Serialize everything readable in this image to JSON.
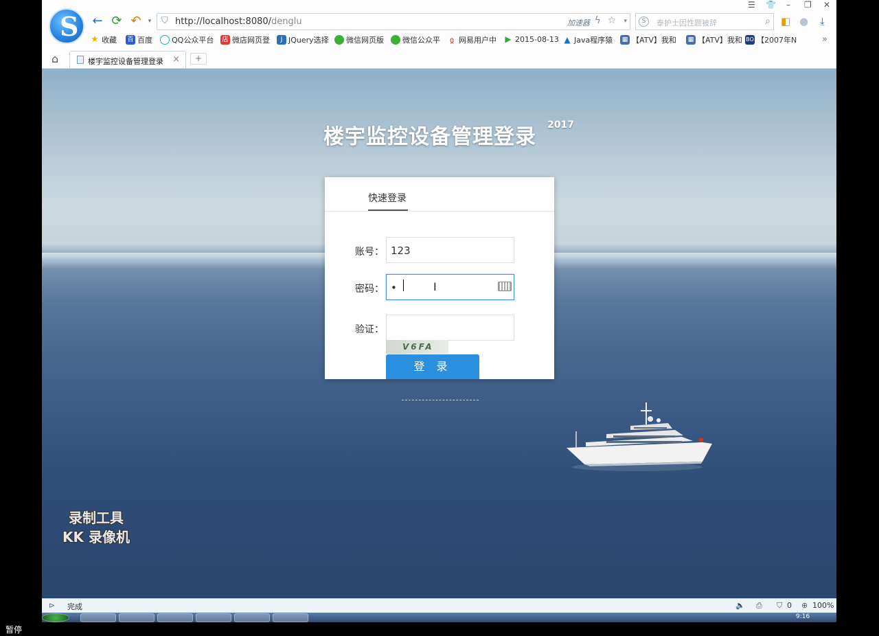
{
  "browser": {
    "logo_letter": "S",
    "address_url_host": "http://localhost:8080/",
    "address_url_path": "denglu",
    "accelerator_label": "加速器",
    "search_placeholder": "泰护士因性题被辞",
    "window_controls": [
      "☰",
      "👕",
      "–",
      "❐",
      "✕"
    ]
  },
  "bookmarks": [
    {
      "label": "收藏",
      "icon": "star-icon",
      "color": "#f0b400"
    },
    {
      "label": "百度",
      "icon": "baidu-icon",
      "color": "#2d5bd6"
    },
    {
      "label": "QQ公众平台",
      "icon": "qq-icon",
      "color": "#1aa3e8"
    },
    {
      "label": "微店网页登",
      "icon": "weidian-icon",
      "color": "#e53935"
    },
    {
      "label": "JQuery选择",
      "icon": "jquery-icon",
      "color": "#2a6fb8"
    },
    {
      "label": "微信网页版",
      "icon": "wechat-icon",
      "color": "#3cb034"
    },
    {
      "label": "微信公众平",
      "icon": "wechat-icon",
      "color": "#3cb034"
    },
    {
      "label": "网易用户中",
      "icon": "netease-icon",
      "color": "#d8262a"
    },
    {
      "label": "2015-08-13",
      "icon": "play-icon",
      "color": "#37a93c"
    },
    {
      "label": "Java程序猿",
      "icon": "java-icon",
      "color": "#1e6fc8"
    },
    {
      "label": "【ATV】我和",
      "icon": "atv-icon",
      "color": "#4a6fa5"
    },
    {
      "label": "【ATV】我和",
      "icon": "atv-icon",
      "color": "#4a6fa5"
    },
    {
      "label": "【2007年N",
      "icon": "bo-icon",
      "color": "#1f3e7a"
    }
  ],
  "tab": {
    "title": "楼宇监控设备管理登录",
    "close": "×",
    "new_tab": "+"
  },
  "page": {
    "title": "楼宇监控设备管理登录",
    "year": "2017",
    "card_tab": "快速登录",
    "account_label": "账号：",
    "account_value": "123",
    "password_label": "密码：",
    "password_value": "•",
    "verify_label": "验证：",
    "verify_value": "",
    "captcha_text": "V6FA",
    "login_button": "登 录"
  },
  "watermark": {
    "line1": "录制工具",
    "line2": "KK 录像机"
  },
  "statusbar": {
    "status_text": "完成",
    "block_count": "0",
    "zoom": "100%"
  },
  "taskbar": {
    "clock": "9:16"
  },
  "overlay": {
    "pause_label": "暂停"
  }
}
